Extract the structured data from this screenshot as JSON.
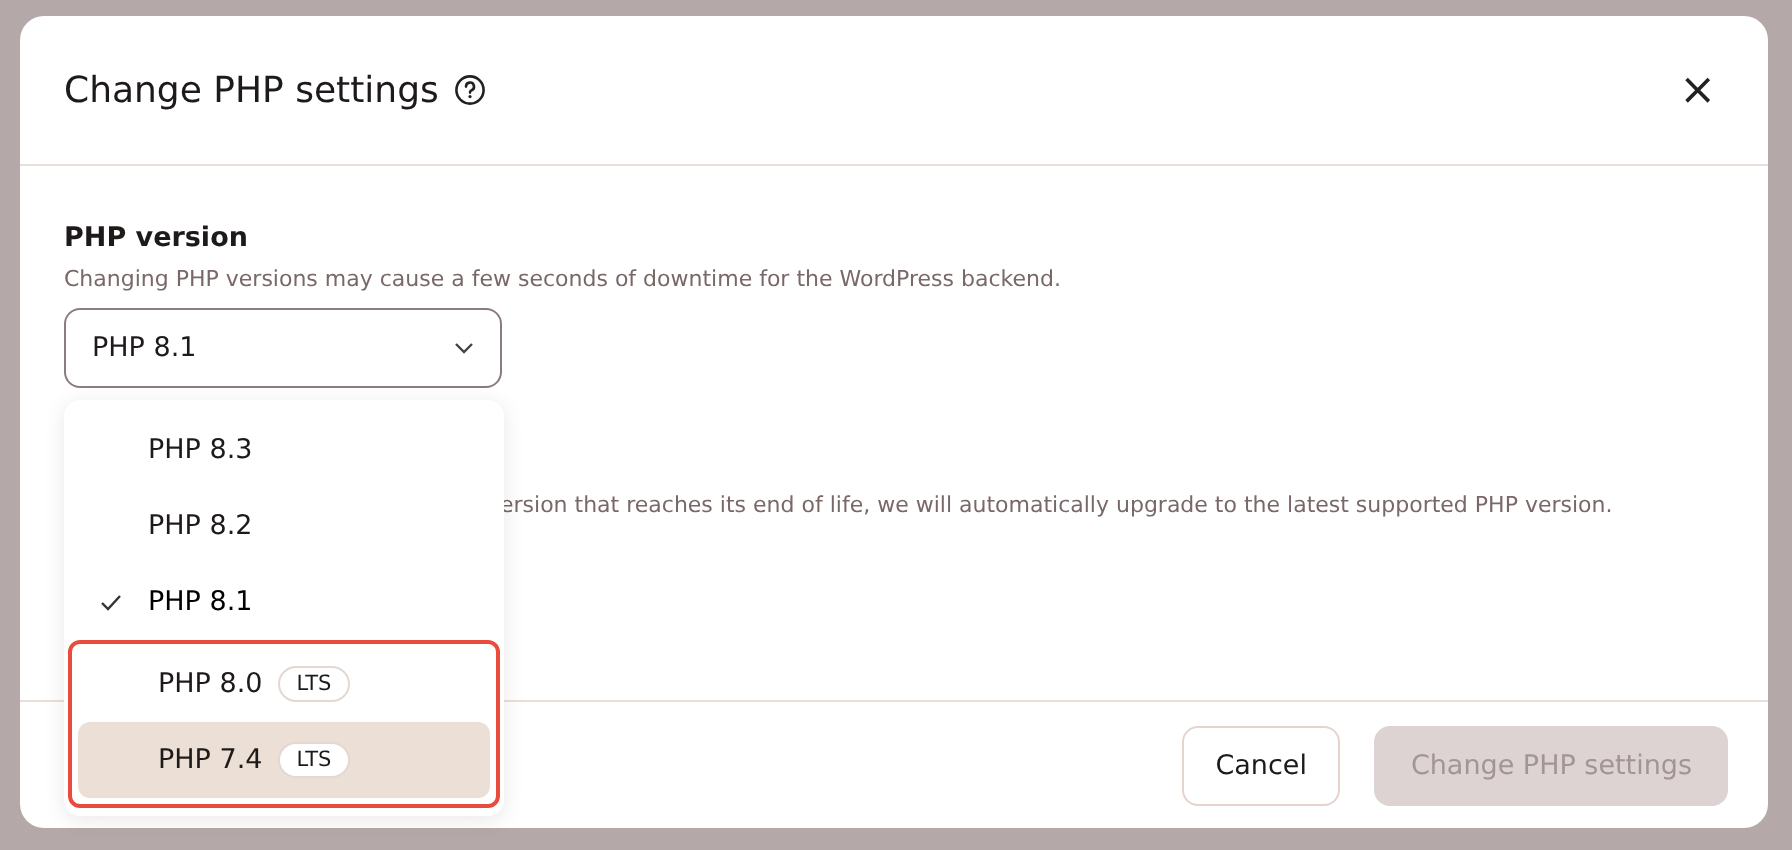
{
  "dialog": {
    "title": "Change PHP settings",
    "close_label": "×",
    "field": {
      "label": "PHP version",
      "description": "Changing PHP versions may cause a few seconds of downtime for the WordPress backend.",
      "value": "PHP 8.1",
      "expanded": true
    },
    "options": [
      {
        "label": "PHP 8.3",
        "selected": false,
        "highlighted": false,
        "outlined": false
      },
      {
        "label": "PHP 8.2",
        "selected": false,
        "highlighted": false,
        "outlined": false
      },
      {
        "label": "PHP 8.1",
        "selected": true,
        "highlighted": false,
        "outlined": false
      },
      {
        "label": "PHP 8.0",
        "badge": "LTS",
        "selected": false,
        "highlighted": false,
        "outlined": true
      },
      {
        "label": "PHP 7.4",
        "badge": "LTS",
        "selected": false,
        "highlighted": true,
        "outlined": true
      }
    ],
    "partial_note": "ersion that reaches its end of life, we will automatically upgrade to the latest supported PHP version.",
    "buttons": [
      {
        "label": "Cancel",
        "disabled": false,
        "kind": "secondary"
      },
      {
        "label": "Change PHP settings",
        "disabled": true,
        "kind": "primary"
      }
    ]
  }
}
